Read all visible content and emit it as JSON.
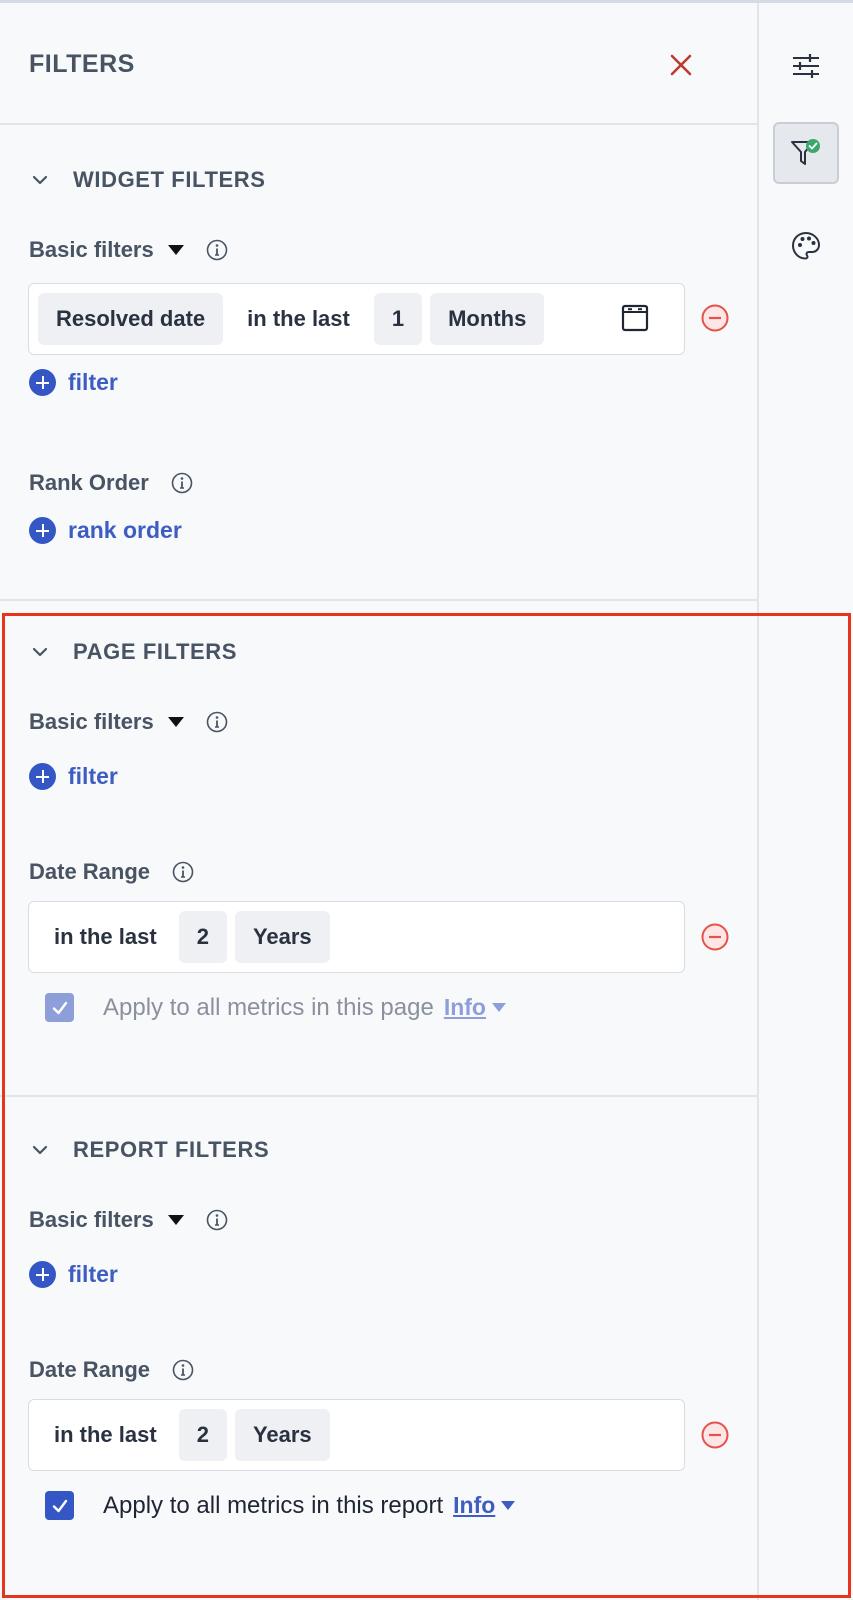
{
  "panel": {
    "title": "FILTERS"
  },
  "widget_filters": {
    "section_title": "WIDGET FILTERS",
    "basic_label": "Basic filters",
    "filter_row": {
      "field": "Resolved date",
      "operator": "in the last",
      "value": "1",
      "unit": "Months"
    },
    "add_filter": "filter",
    "rank_label": "Rank Order",
    "add_rank": "rank order"
  },
  "page_filters": {
    "section_title": "PAGE FILTERS",
    "basic_label": "Basic filters",
    "add_filter": "filter",
    "date_label": "Date Range",
    "date_row": {
      "operator": "in the last",
      "value": "2",
      "unit": "Years"
    },
    "apply_text": "Apply to all metrics in this page",
    "apply_checked": true,
    "apply_disabled": true,
    "info": "Info"
  },
  "report_filters": {
    "section_title": "REPORT FILTERS",
    "basic_label": "Basic filters",
    "add_filter": "filter",
    "date_label": "Date Range",
    "date_row": {
      "operator": "in the last",
      "value": "2",
      "unit": "Years"
    },
    "apply_text": "Apply to all metrics in this report",
    "apply_checked": true,
    "info": "Info"
  },
  "rail": {
    "items": [
      {
        "icon": "sliders-icon",
        "active": false
      },
      {
        "icon": "filter-check-icon",
        "active": true
      },
      {
        "icon": "palette-icon",
        "active": false
      }
    ]
  },
  "colors": {
    "accent": "#3557c6",
    "remove": "#e4534a",
    "highlight": "#e8341d",
    "check_badge": "#3aa76d"
  }
}
